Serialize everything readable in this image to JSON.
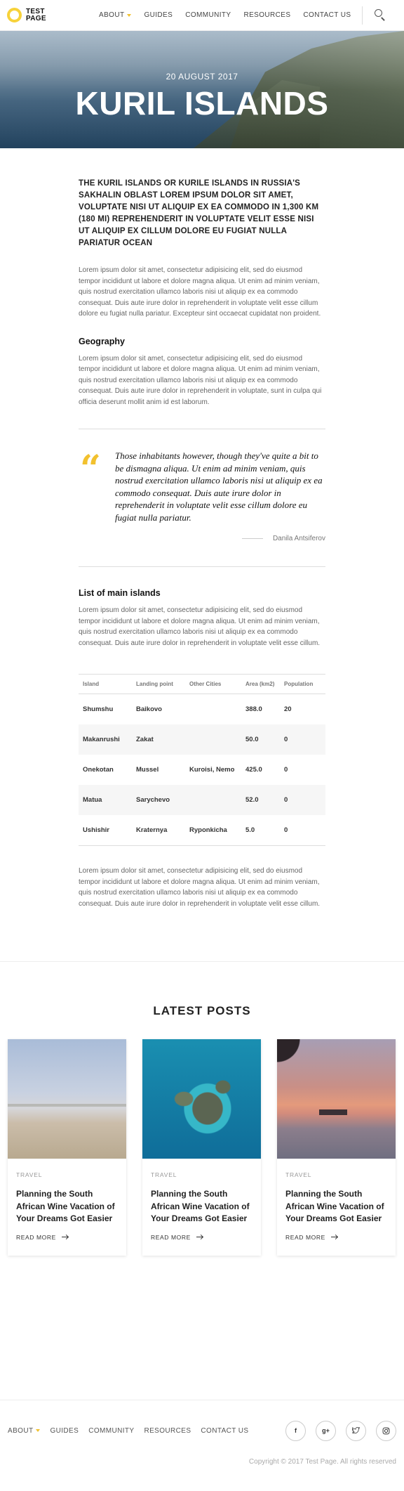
{
  "header": {
    "logo_text": "TEST PAGE",
    "nav": [
      "ABOUT",
      "GUIDES",
      "COMMUNITY",
      "RESOURCES",
      "CONTACT US"
    ]
  },
  "hero": {
    "date": "20 AUGUST 2017",
    "title": "KURIL ISLANDS"
  },
  "article": {
    "lead": "THE KURIL ISLANDS OR KURILE ISLANDS IN RUSSIA'S SAKHALIN OBLAST LOREM IPSUM DOLOR SIT AMET, VOLUPTATE NISI UT ALIQUIP EX EA COMMODO IN 1,300 KM (180 MI) REPREHENDERIT IN VOLUPTATE VELIT ESSE NISI UT ALIQUIP EX CILLUM DOLORE EU FUGIAT NULLA PARIATUR OCEAN",
    "para1": "Lorem ipsum dolor sit amet, consectetur adipisicing elit, sed do eiusmod tempor incididunt ut labore et dolore magna aliqua. Ut enim ad minim veniam, quis nostrud exercitation ullamco laboris nisi ut aliquip ex ea commodo consequat. Duis aute irure dolor in reprehenderit in voluptate velit esse cillum dolore eu fugiat nulla pariatur. Excepteur sint occaecat cupidatat non proident.",
    "geography_title": "Geography",
    "geography_text": "Lorem ipsum dolor sit amet, consectetur adipisicing elit, sed do eiusmod tempor incididunt ut labore et dolore magna aliqua. Ut enim ad minim veniam, quis nostrud exercitation ullamco laboris nisi ut aliquip ex ea commodo consequat. Duis aute irure dolor in reprehenderit in voluptate, sunt in culpa qui officia deserunt mollit anim id est laborum.",
    "quote": "Those inhabitants however, though they've quite a bit to be dismagna aliqua. Ut enim ad minim veniam, quis nostrud exercitation ullamco laboris nisi ut aliquip ex ea commodo consequat. Duis aute irure dolor in reprehenderit in voluptate velit esse cillum dolore eu fugiat nulla pariatur.",
    "quote_author": "Danila Antsiferov",
    "islands_title": "List of main islands",
    "islands_text": "Lorem ipsum dolor sit amet, consectetur adipisicing elit, sed do eiusmod tempor incididunt ut labore et dolore magna aliqua. Ut enim ad minim veniam, quis nostrud exercitation ullamco laboris nisi ut aliquip ex ea commodo consequat. Duis aute irure dolor in reprehenderit in voluptate velit esse cillum.",
    "table": {
      "headers": [
        "Island",
        "Landing point",
        "Other Cities",
        "Area (km2)",
        "Population"
      ],
      "rows": [
        [
          "Shumshu",
          "Baikovo",
          "",
          "388.0",
          "20"
        ],
        [
          "Makanrushi",
          "Zakat",
          "",
          "50.0",
          "0"
        ],
        [
          "Onekotan",
          "Mussel",
          "Kuroisi, Nemo",
          "425.0",
          "0"
        ],
        [
          "Matua",
          "Sarychevo",
          "",
          "52.0",
          "0"
        ],
        [
          "Ushishir",
          "Kraternya",
          "Ryponkicha",
          "5.0",
          "0"
        ]
      ]
    },
    "closing_text": "Lorem ipsum dolor sit amet, consectetur adipisicing elit, sed do eiusmod tempor incididunt ut labore et dolore magna aliqua. Ut enim ad minim veniam, quis nostrud exercitation ullamco laboris nisi ut aliquip ex ea commodo consequat. Duis aute irure dolor in reprehenderit in voluptate velit esse cillum."
  },
  "latest": {
    "title": "LATEST POSTS",
    "posts": [
      {
        "category": "TRAVEL",
        "title": "Planning the South African Wine Vacation of Your Dreams Got Easier",
        "more": "READ MORE"
      },
      {
        "category": "TRAVEL",
        "title": "Planning the South African Wine Vacation of Your Dreams Got Easier",
        "more": "READ MORE"
      },
      {
        "category": "TRAVEL",
        "title": "Planning the South African Wine Vacation of Your Dreams Got Easier",
        "more": "READ MORE"
      }
    ]
  },
  "footer": {
    "nav": [
      "ABOUT",
      "GUIDES",
      "COMMUNITY",
      "RESOURCES",
      "CONTACT US"
    ],
    "socials": [
      "facebook-icon",
      "google-plus-icon",
      "twitter-icon",
      "instagram-icon"
    ],
    "copyright": "Copyright © 2017 Test Page. All rights reserved"
  },
  "colors": {
    "accent": "#f2c12e"
  }
}
